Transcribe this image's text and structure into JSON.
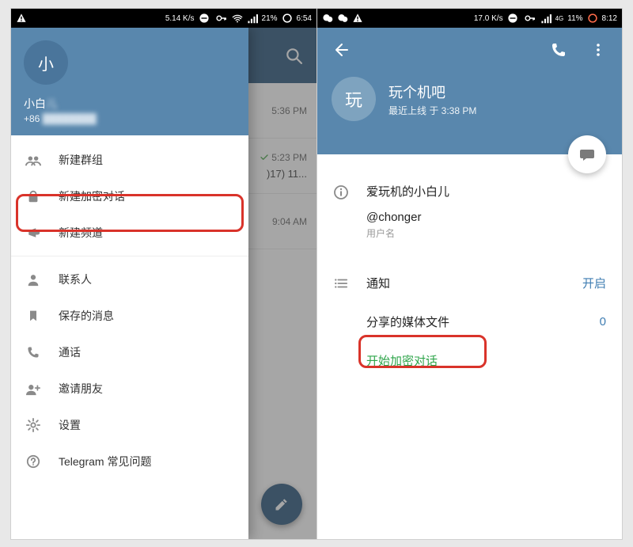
{
  "left": {
    "status": {
      "speed": "5.14 K/s",
      "battery": "21%",
      "time": "6:54"
    },
    "drawer": {
      "avatar_letter": "小",
      "name": "小白",
      "phone_prefix": "+86",
      "phone_blur": "████████",
      "items": [
        {
          "icon": "group",
          "label": "新建群组"
        },
        {
          "icon": "lock",
          "label": "新建加密对话"
        },
        {
          "icon": "megaphone",
          "label": "新建频道"
        }
      ],
      "items2": [
        {
          "icon": "contact",
          "label": "联系人"
        },
        {
          "icon": "bookmark",
          "label": "保存的消息"
        },
        {
          "icon": "call",
          "label": "通话"
        },
        {
          "icon": "invite",
          "label": "邀请朋友"
        },
        {
          "icon": "settings",
          "label": "设置"
        },
        {
          "icon": "help",
          "label": "Telegram 常见问题"
        }
      ]
    },
    "chat_times": [
      "5:36 PM",
      "5:23 PM",
      "9:04 AM"
    ],
    "chat_preview": ")17) 11..."
  },
  "right": {
    "status": {
      "speed": "17.0 K/s",
      "network": "4G",
      "battery": "11%",
      "time": "8:12"
    },
    "profile": {
      "avatar_letter": "玩",
      "name": "玩个机吧",
      "last_seen": "最近上线 于 3:38 PM",
      "display_name": "爱玩机的小白儿",
      "username": "@chonger",
      "username_label": "用户名",
      "notifications_label": "通知",
      "notifications_value": "开启",
      "shared_media_label": "分享的媒体文件",
      "shared_media_count": "0",
      "start_secret_chat": "开始加密对话"
    }
  }
}
